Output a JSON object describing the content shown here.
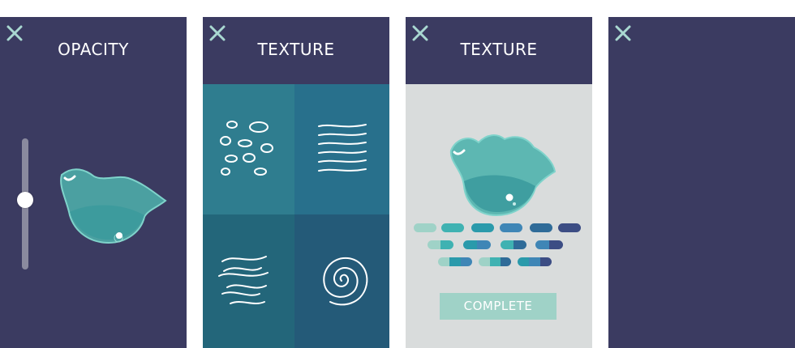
{
  "colors": {
    "screen_bg": "#3b3b61",
    "close_icon": "#a9d8d1",
    "blob_fill": "#4fb3ad",
    "panel_bg": "#d9dcdc",
    "complete_button": "#9fd2c7"
  },
  "screens": [
    {
      "title": "OPACITY",
      "slider": {
        "value": 0.43
      }
    },
    {
      "title": "TEXTURE",
      "textures": [
        "dots",
        "lines",
        "waves",
        "swirl"
      ]
    },
    {
      "title": "TEXTURE",
      "complete_label": "COMPLETE"
    },
    {
      "title": ""
    }
  ]
}
